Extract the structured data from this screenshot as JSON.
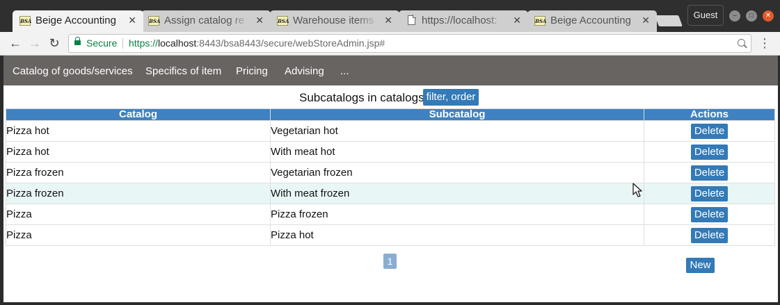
{
  "browser": {
    "tabs": [
      {
        "title": "Beige Accounting",
        "favicon": "BSA",
        "active": true
      },
      {
        "title": "Assign catalog re",
        "favicon": "BSA",
        "active": false
      },
      {
        "title": "Warehouse items",
        "favicon": "BSA",
        "active": false
      },
      {
        "title": "https://localhost:",
        "favicon": "document-icon",
        "active": false
      },
      {
        "title": "Beige Accounting",
        "favicon": "BSA",
        "active": false
      }
    ],
    "tab_close_glyph": "✕",
    "profile_label": "Guest",
    "window_buttons": {
      "minimize": "–",
      "maximize": "□",
      "close": "✕"
    },
    "nav": {
      "back": "←",
      "forward": "→",
      "reload": "↻",
      "menu": "⋮"
    },
    "secure_label": "Secure",
    "url": {
      "scheme": "https://",
      "host": "localhost",
      "rest": ":8443/bsa8443/secure/webStoreAdmin.jsp#"
    }
  },
  "app_nav": {
    "items": [
      "Catalog of goods/services",
      "Specifics of item",
      "Pricing",
      "Advising",
      "..."
    ]
  },
  "main": {
    "heading": "Subcatalogs in catalogs",
    "filter_button": "filter, order",
    "table": {
      "columns": [
        "Catalog",
        "Subcatalog",
        "Actions"
      ],
      "rows": [
        {
          "catalog": "Pizza hot",
          "subcatalog": "Vegetarian hot",
          "action": "Delete"
        },
        {
          "catalog": "Pizza hot",
          "subcatalog": "With meat hot",
          "action": "Delete"
        },
        {
          "catalog": "Pizza frozen",
          "subcatalog": "Vegetarian frozen",
          "action": "Delete"
        },
        {
          "catalog": "Pizza frozen",
          "subcatalog": "With meat frozen",
          "action": "Delete"
        },
        {
          "catalog": "Pizza",
          "subcatalog": "Pizza frozen",
          "action": "Delete"
        },
        {
          "catalog": "Pizza",
          "subcatalog": "Pizza hot",
          "action": "Delete"
        }
      ]
    },
    "pagination": {
      "current_page": "1"
    },
    "new_button": "New"
  },
  "colors": {
    "nav_bg": "#686462",
    "table_header_bg": "#3f81c1",
    "button_bg": "#337ab7",
    "row_highlight": "#e9f6f6",
    "secure_green": "#0b8043"
  }
}
